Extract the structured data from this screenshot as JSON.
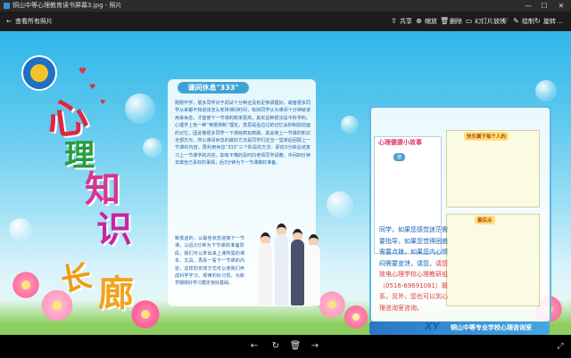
{
  "window": {
    "title": "铜山中等心理教育读书屏幕3.jpg - 照片",
    "controls": {
      "minimize": "—",
      "maximize": "☐",
      "close": "✕"
    }
  },
  "toolbar": {
    "back_label": "查看所有照片",
    "items": [
      {
        "label": "共享",
        "icon": "share-icon",
        "glyph": "⇪"
      },
      {
        "label": "缩放",
        "icon": "zoom-icon",
        "glyph": "⊕"
      },
      {
        "label": "删除",
        "icon": "delete-icon",
        "glyph": "🗑"
      },
      {
        "label": "幻灯片放映",
        "icon": "slideshow-icon",
        "glyph": "▭"
      },
      {
        "label": "收藏",
        "icon": "favorite-icon",
        "glyph": "♡"
      },
      {
        "label": "绘制",
        "icon": "draw-icon",
        "glyph": "✎"
      },
      {
        "label": "编辑",
        "icon": "edit-icon",
        "glyph": "▣"
      },
      {
        "label": "旋转",
        "icon": "rotate-icon",
        "glyph": "↻"
      },
      {
        "label": "...",
        "icon": "more-icon",
        "glyph": ""
      }
    ]
  },
  "poster": {
    "big_chars": [
      "心",
      "理",
      "知",
      "识",
      "长",
      "廊"
    ],
    "panel1": {
      "title": "课间休息\"333\"",
      "paragraph": "刚刚开学，很多同学对于调试十分种还没有足够调理好，或者很多同学从来都不知道该怎么安排课间时间，有的同学认为课间十分钟就该用来休息，才能使下一节课的效率更高，其实这种想法是不科学的。心理学上有一种“倒摄抑制”理论，意思是后边过的记忆会抑制前前面的记忆，因此像很多同学一下课就疯玩疯跳，其会使上一节课的知识全部忘光。所以课间休息的最好方法是同学们应当一堂课后回顾上一节课的内容，再利用休息“333”三个阶段的方法：即前3分钟总结复习上一节课学的内容，如有不懂的及时向老师同学请教；中间四分钟去做自己喜欢的事情；后3分钟为下一节课做好准备。",
      "paragraph_b": "致低迷的，以最佳状态迎接下一节课。以后3分钟为下节课的准备阶段，我们可以拿出来上课所需的课本、文具，再看一看下一节课的内容，这样的安排方式可以使我们养成科学学习、规律的好习惯，为新学期搞好学习奠定良好基础。"
    },
    "panel2": {
      "heading": "心理健康小故事",
      "subheading": "窗",
      "box2_title": "快乐属于每个人的",
      "box3_title": "最后点",
      "blue_text_1": "同学，如果您感觉迷茫需要指导，如果您觉得困惑需要点拨，如果您内心烦闷需要宣泄，请您",
      "blue_text_2": "，请您致电心理学校心理教研组（0516-69691081）联系，另外，您也可以到心理咨询室咨询。",
      "footer": "铜山中等专业学校心理咨询室",
      "footer_logo": "XY"
    }
  },
  "bottom_nav": {
    "prev": "←",
    "rotate": "↻",
    "delete": "🗑",
    "next": "→",
    "fullscreen": "⤢"
  }
}
